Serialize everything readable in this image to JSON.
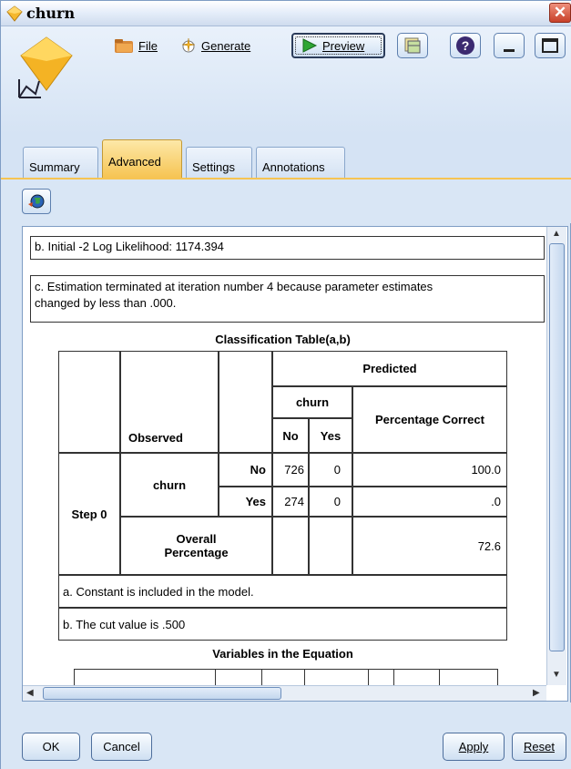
{
  "window": {
    "title": "churn",
    "close_glyph": "✕"
  },
  "toolbar": {
    "file_label": "File",
    "generate_label": "Generate",
    "preview_label": "Preview",
    "help_glyph": "?"
  },
  "tabs": [
    {
      "label": "Summary",
      "active": false
    },
    {
      "label": "Advanced",
      "active": true
    },
    {
      "label": "Settings",
      "active": false
    },
    {
      "label": "Annotations",
      "active": false
    }
  ],
  "output": {
    "note_b_top": "b. Initial -2 Log Likelihood: 1174.394",
    "note_c_line1": "c. Estimation terminated at iteration number 4 because parameter estimates",
    "note_c_line2": "changed by less than .000.",
    "classification_title": "Classification Table(a,b)",
    "headers": {
      "predicted": "Predicted",
      "churn": "churn",
      "percentage_correct": "Percentage Correct",
      "observed": "Observed",
      "no": "No",
      "yes": "Yes"
    },
    "step": "Step 0",
    "row_var": "churn",
    "rows": [
      {
        "label": "No",
        "no": "726",
        "yes": "0",
        "pct": "100.0"
      },
      {
        "label": "Yes",
        "no": "274",
        "yes": "0",
        "pct": ".0"
      }
    ],
    "overall_line1": "Overall",
    "overall_line2": "Percentage",
    "overall_pct": "72.6",
    "footnote_a": "a. Constant is included in the model.",
    "footnote_b": "b. The cut value is .500",
    "variables_title": "Variables in the Equation"
  },
  "buttons": {
    "ok": "OK",
    "cancel": "Cancel",
    "apply": "Apply",
    "reset": "Reset"
  },
  "colors": {
    "active_tab": "#f6c453",
    "window_bg": "#d9e6f5",
    "close": "#c8412a"
  }
}
